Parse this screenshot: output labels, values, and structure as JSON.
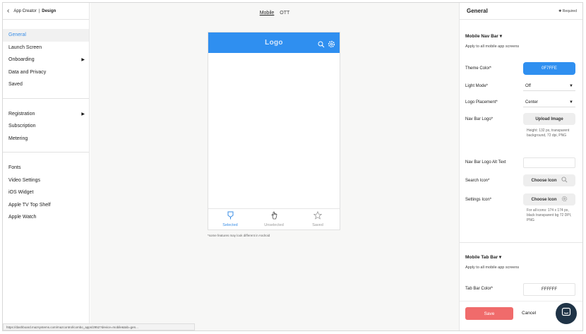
{
  "breadcrumb": {
    "parent": "App Creator",
    "current": "Design"
  },
  "sidebar": {
    "group1": [
      {
        "label": "General",
        "active": true
      },
      {
        "label": "Launch Screen"
      },
      {
        "label": "Onboarding",
        "arrow": true
      },
      {
        "label": "Data and Privacy"
      },
      {
        "label": "Saved"
      }
    ],
    "group2": [
      {
        "label": "Registration",
        "arrow": true
      },
      {
        "label": "Subscription"
      },
      {
        "label": "Metering"
      }
    ],
    "group3": [
      {
        "label": "Fonts"
      },
      {
        "label": "Video Settings"
      },
      {
        "label": "iOS Widget"
      },
      {
        "label": "Apple TV Top Shelf"
      },
      {
        "label": "Apple Watch"
      }
    ]
  },
  "device_toggle": {
    "mobile": "Mobile",
    "ott": "OTT",
    "selected": "Mobile"
  },
  "preview": {
    "logo": "Logo",
    "tabs": [
      {
        "label": "Selected",
        "icon": "bookmark-icon"
      },
      {
        "label": "Unselected",
        "icon": "hand-icon"
      },
      {
        "label": "Saved",
        "icon": "star-icon"
      }
    ],
    "footnote": "*some features may look different in Android"
  },
  "panel": {
    "title": "General",
    "required": "Required",
    "nav_section": {
      "title": "Mobile Nav Bar",
      "subtitle": "Apply to all mobile app screens",
      "theme_color_label": "Theme Color*",
      "theme_color_value": "0F7FFE",
      "light_mode_label": "Light Mode*",
      "light_mode_value": "Off",
      "logo_placement_label": "Logo Placement*",
      "logo_placement_value": "Center",
      "nav_logo_label": "Nav Bar Logo*",
      "upload_label": "Upload Image",
      "logo_hint": "Height: 132 px, transparent background, 72 dpi, PNG",
      "alt_text_label": "Nav Bar Logo Alt Text",
      "alt_text_value": "",
      "search_icon_label": "Search Icon*",
      "settings_icon_label": "Settings Icon*",
      "choose_icon": "Choose Icon",
      "icon_hint": "For all icons: 174 x 174 px, black transparent bg 72 DPI, PNG"
    },
    "tab_section": {
      "title": "Mobile Tab Bar",
      "subtitle": "Apply to all mobile app screens",
      "tab_color_label": "Tab Bar Color*",
      "tab_color_value": "FFFFFF"
    },
    "save": "Save",
    "cancel": "Cancel"
  },
  "status_url": "https://dashboard.mazsystems.com/mazcontrol/combo_apps/2952?device=mobile&tab=gen...",
  "colors": {
    "accent": "#2F8FF0",
    "save": "#F06B6B",
    "chat": "#1F3346"
  }
}
